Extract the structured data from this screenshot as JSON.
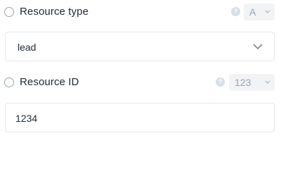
{
  "resource_type": {
    "label": "Resource type",
    "help_icon": "?",
    "type_toggle": "A",
    "value": "lead",
    "icons": {
      "radio": "radio-empty-icon",
      "help": "question-icon",
      "dropdown": "chevron-down-icon"
    }
  },
  "resource_id": {
    "label": "Resource ID",
    "help_icon": "?",
    "type_toggle": "123",
    "value": "1234",
    "icons": {
      "radio": "radio-empty-icon",
      "help": "question-icon",
      "dropdown": "chevron-down-icon"
    }
  },
  "colors": {
    "text": "#1f2933",
    "muted": "#9aa5b1",
    "border": "#e4e7eb",
    "toggle_bg": "#f1f3f5"
  }
}
